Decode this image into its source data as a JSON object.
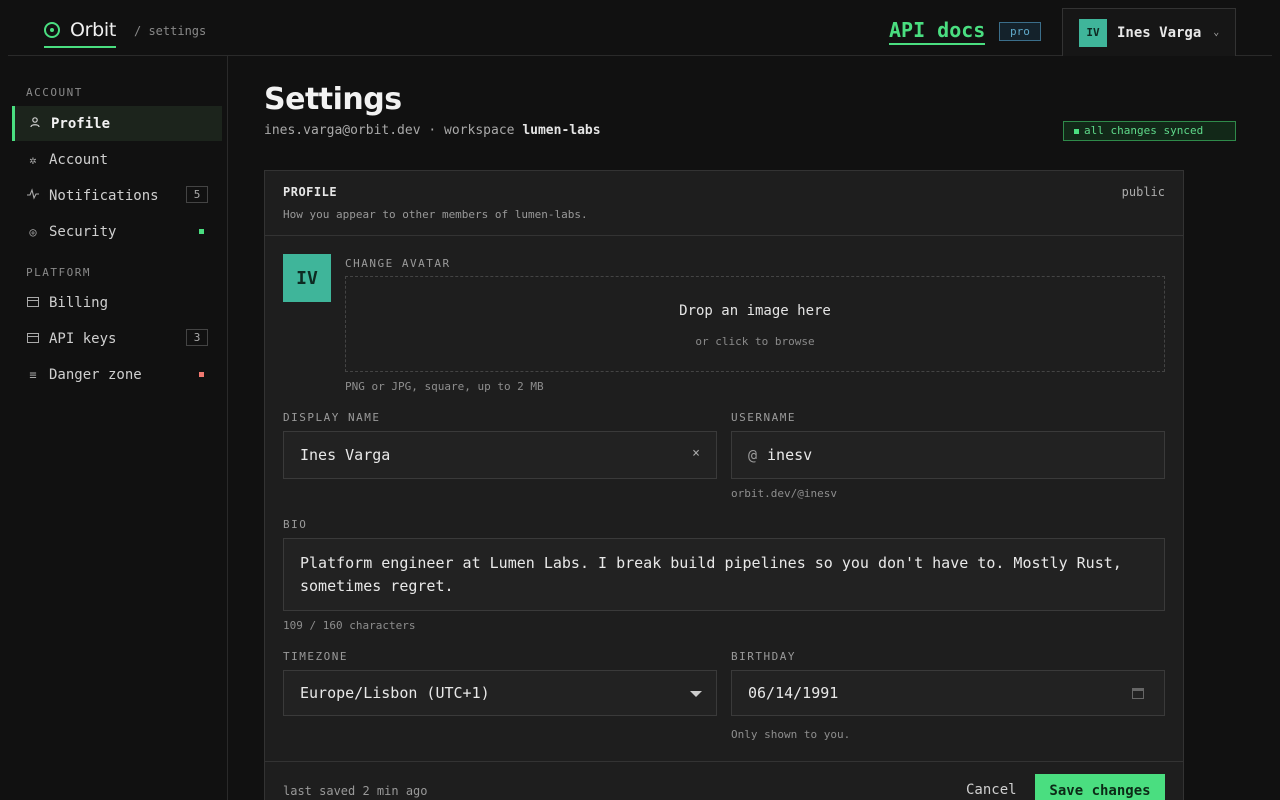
{
  "topbar": {
    "brand": "Orbit",
    "breadcrumb": "/ settings",
    "api_docs": "API docs",
    "plan_badge": "pro",
    "user_initials": "IV",
    "user_name": "Ines Varga",
    "user_chevron": "⌄"
  },
  "sidebar": {
    "account_heading": "ACCOUNT",
    "platform_heading": "PLATFORM",
    "items": [
      {
        "label": "Profile",
        "icon": "user-icon",
        "active": true
      },
      {
        "label": "Account",
        "icon": "gear-icon"
      },
      {
        "label": "Notifications",
        "icon": "pulse-icon",
        "count": "5"
      },
      {
        "label": "Security",
        "icon": "shield-icon",
        "status": "green"
      },
      {
        "label": "Billing",
        "icon": "card-icon"
      },
      {
        "label": "API keys",
        "icon": "key-icon",
        "count": "3"
      },
      {
        "label": "Danger zone",
        "icon": "list-icon",
        "status": "red"
      }
    ]
  },
  "header": {
    "title": "Settings",
    "email": "ines.varga@orbit.dev",
    "separator": "·",
    "workspace_label": "workspace",
    "workspace": "lumen-labs",
    "sync_status": "all changes synced"
  },
  "profile_card": {
    "title": "PROFILE",
    "description": "How you appear to other members of lumen-labs.",
    "visibility": "public",
    "avatar_initials": "IV",
    "avatar_label": "CHANGE AVATAR",
    "drop_title": "Drop an image here",
    "drop_sub": "or click to browse",
    "avatar_hint": "PNG or JPG, square, up to 2 MB",
    "display_name_label": "DISPLAY NAME",
    "display_name": "Ines Varga",
    "clear_glyph": "×",
    "username_label": "USERNAME",
    "username_prefix": "@",
    "username": "inesv",
    "username_hint": "orbit.dev/@inesv",
    "bio_label": "BIO",
    "bio": "Platform engineer at Lumen Labs. I break build pipelines so you don't have to. Mostly Rust, sometimes regret.",
    "bio_count": "109 / 160 characters",
    "timezone_label": "TIMEZONE",
    "timezone": "Europe/Lisbon (UTC+1)",
    "birthday_label": "BIRTHDAY",
    "birthday": "06/14/1991",
    "birthday_hint": "Only shown to you.",
    "last_saved": "last saved 2 min ago",
    "cancel_label": "Cancel",
    "save_label": "Save changes"
  },
  "colors": {
    "accent": "#4ade80",
    "avatar": "#3fb59a",
    "danger": "#f07870",
    "background": "#111111"
  }
}
